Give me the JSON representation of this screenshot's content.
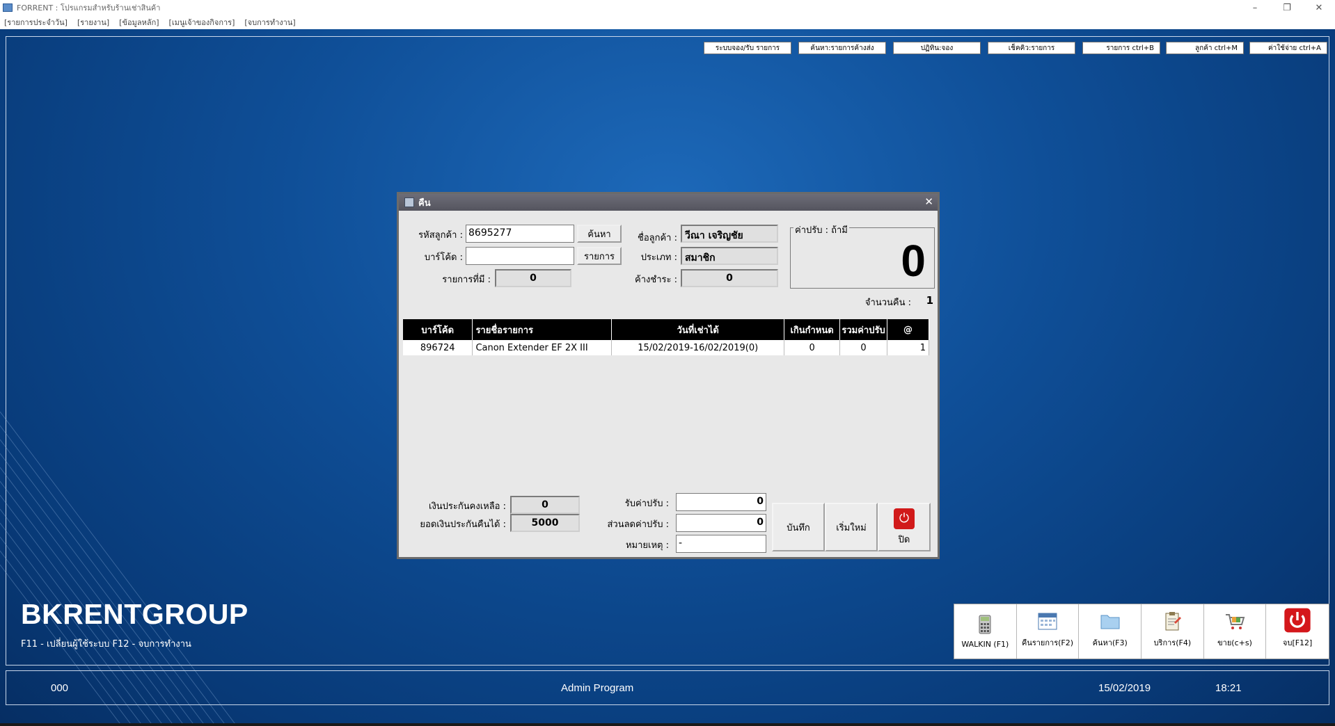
{
  "window": {
    "title": "FORRENT : โปรแกรมสำหรับร้านเช่าสินค้า",
    "controls": {
      "minimize": "–",
      "restore": "❐",
      "close": "✕"
    }
  },
  "menu": [
    "[รายการประจำวัน]",
    "[รายงาน]",
    "[ข้อมูลหลัก]",
    "[เมนูเจ้าของกิจการ]",
    "[จบการทำงาน]"
  ],
  "shortcuts": [
    "ระบบจอง/รับ รายการ",
    "ค้นหา:รายการค้างส่ง",
    "ปฏิทิน:จอง",
    "เช็คคิว:รายการ",
    "รายการ ctrl+B",
    "ลูกค้า ctrl+M",
    "ค่าใช้จ่าย ctrl+A"
  ],
  "brand": {
    "name": "BKRENTGROUP",
    "help": "F11 - เปลี่ยนผู้ใช้ระบบ    F12 - จบการทำงาน"
  },
  "toolbox": [
    {
      "label": "WALKIN  (F1)",
      "icon": "calculator-icon"
    },
    {
      "label": "คืนรายการ(F2)",
      "icon": "calendar-icon"
    },
    {
      "label": "ค้นหา(F3)",
      "icon": "folder-icon"
    },
    {
      "label": "บริการ(F4)",
      "icon": "clipboard-icon"
    },
    {
      "label": "ขาย(c+s)",
      "icon": "cart-icon"
    },
    {
      "label": "จบ[F12]",
      "icon": "power-icon"
    }
  ],
  "status": {
    "code": "000",
    "program": "Admin Program",
    "date": "15/02/2019",
    "time": "18:21"
  },
  "dialog": {
    "title": "คืน",
    "close": "✕",
    "customer_code_label": "รหัสลูกค้า :",
    "customer_code": "8695277",
    "search_btn": "ค้นหา",
    "barcode_label": "บาร์โค้ด :",
    "barcode": "",
    "list_btn": "รายการ",
    "items_count_label": "รายการที่มี :",
    "items_count": "0",
    "customer_name_label": "ชื่อลูกค้า :",
    "customer_name": "วีณา  เจริญชัย",
    "type_label": "ประเภท :",
    "type": "สมาชิก",
    "outstanding_label": "ค้างชำระ :",
    "outstanding": "0",
    "fine_legend": "ค่าปรับ : ถ้ามี",
    "fine_value": "0",
    "return_count_label": "จำนวนคืน :",
    "return_count": "1",
    "table": {
      "headers": [
        "บาร์โค้ด",
        "รายชื่อรายการ",
        "วันที่เช่าได้",
        "เกินกำหนด",
        "รวมค่าปรับ",
        "@"
      ],
      "rows": [
        [
          "896724",
          "Canon Extender EF 2X III",
          "15/02/2019-16/02/2019(0)",
          "0",
          "0",
          "1"
        ]
      ]
    },
    "deposit_left_label": "เงินประกันคงเหลือ :",
    "deposit_left": "0",
    "deposit_return_label": "ยอดเงินประกันคืนได้ :",
    "deposit_return": "5000",
    "receive_fine_label": "รับค่าปรับ :",
    "receive_fine": "0",
    "discount_fine_label": "ส่วนลดค่าปรับ :",
    "discount_fine": "0",
    "note_label": "หมายเหตุ :",
    "note": "-",
    "save_btn": "บันทึก",
    "reset_btn": "เริ่มใหม่",
    "close_btn": "ปิด"
  }
}
